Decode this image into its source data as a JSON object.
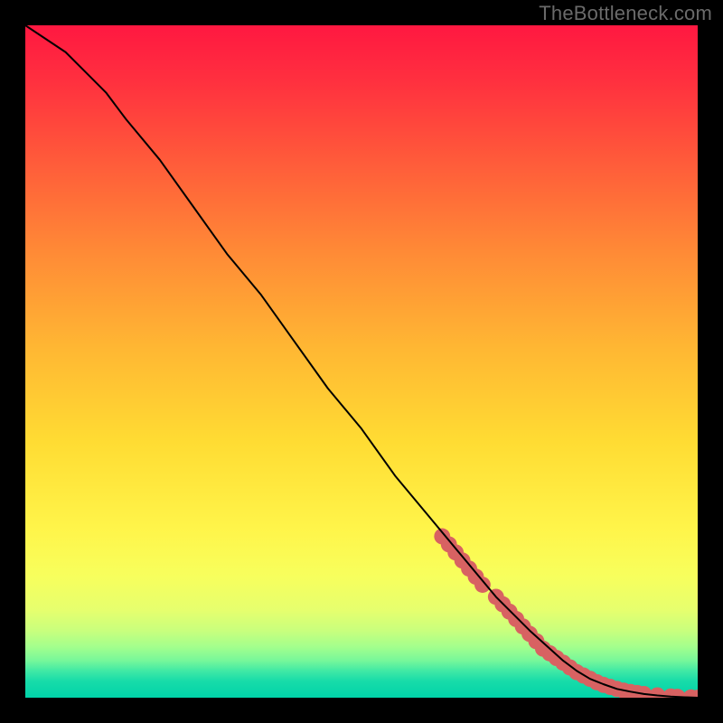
{
  "watermark": "TheBottleneck.com",
  "chart_data": {
    "type": "line",
    "title": "",
    "xlabel": "",
    "ylabel": "",
    "xlim": [
      0,
      100
    ],
    "ylim": [
      0,
      100
    ],
    "grid": false,
    "legend": false,
    "series": [
      {
        "name": "curve",
        "x": [
          0,
          3,
          6,
          9,
          12,
          15,
          20,
          25,
          30,
          35,
          40,
          45,
          50,
          55,
          60,
          65,
          70,
          75,
          80,
          82,
          84,
          86,
          88,
          90,
          92,
          94,
          96,
          98,
          100
        ],
        "y": [
          100,
          98,
          96,
          93,
          90,
          86,
          80,
          73,
          66,
          60,
          53,
          46,
          40,
          33,
          27,
          21,
          15,
          10,
          5.5,
          4.0,
          2.8,
          2.0,
          1.3,
          0.9,
          0.55,
          0.33,
          0.17,
          0.07,
          0.0
        ],
        "stroke": "#000000",
        "stroke_width": 2
      }
    ],
    "scatter": [
      {
        "name": "points",
        "color": "#d86262",
        "radius_pct": 1.2,
        "x": [
          62,
          63,
          64,
          65,
          66,
          67,
          68,
          70,
          71,
          72,
          73,
          74,
          75,
          76,
          77,
          78,
          79,
          80,
          81,
          82,
          83,
          84,
          85,
          86,
          87,
          88,
          89,
          90,
          91,
          92,
          94,
          96,
          97,
          99,
          100
        ],
        "y": [
          24.0,
          22.8,
          21.6,
          20.4,
          19.2,
          18.0,
          16.8,
          15.0,
          13.9,
          12.8,
          11.7,
          10.6,
          9.5,
          8.4,
          7.3,
          6.6,
          5.9,
          5.2,
          4.5,
          3.8,
          3.3,
          2.8,
          2.3,
          1.9,
          1.6,
          1.3,
          1.05,
          0.85,
          0.7,
          0.55,
          0.35,
          0.18,
          0.12,
          0.04,
          0.0
        ]
      }
    ]
  }
}
